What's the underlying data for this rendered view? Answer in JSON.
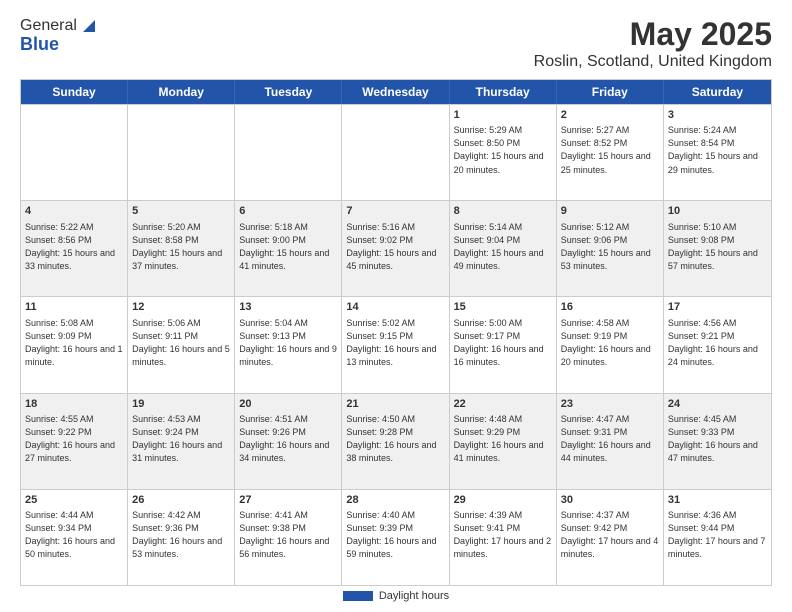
{
  "logo": {
    "general": "General",
    "blue": "Blue"
  },
  "title": "May 2025",
  "subtitle": "Roslin, Scotland, United Kingdom",
  "daylight_label": "Daylight hours",
  "weekdays": [
    "Sunday",
    "Monday",
    "Tuesday",
    "Wednesday",
    "Thursday",
    "Friday",
    "Saturday"
  ],
  "weeks": [
    [
      {
        "day": "",
        "info": ""
      },
      {
        "day": "",
        "info": ""
      },
      {
        "day": "",
        "info": ""
      },
      {
        "day": "",
        "info": ""
      },
      {
        "day": "1",
        "info": "Sunrise: 5:29 AM\nSunset: 8:50 PM\nDaylight: 15 hours and 20 minutes."
      },
      {
        "day": "2",
        "info": "Sunrise: 5:27 AM\nSunset: 8:52 PM\nDaylight: 15 hours and 25 minutes."
      },
      {
        "day": "3",
        "info": "Sunrise: 5:24 AM\nSunset: 8:54 PM\nDaylight: 15 hours and 29 minutes."
      }
    ],
    [
      {
        "day": "4",
        "info": "Sunrise: 5:22 AM\nSunset: 8:56 PM\nDaylight: 15 hours and 33 minutes."
      },
      {
        "day": "5",
        "info": "Sunrise: 5:20 AM\nSunset: 8:58 PM\nDaylight: 15 hours and 37 minutes."
      },
      {
        "day": "6",
        "info": "Sunrise: 5:18 AM\nSunset: 9:00 PM\nDaylight: 15 hours and 41 minutes."
      },
      {
        "day": "7",
        "info": "Sunrise: 5:16 AM\nSunset: 9:02 PM\nDaylight: 15 hours and 45 minutes."
      },
      {
        "day": "8",
        "info": "Sunrise: 5:14 AM\nSunset: 9:04 PM\nDaylight: 15 hours and 49 minutes."
      },
      {
        "day": "9",
        "info": "Sunrise: 5:12 AM\nSunset: 9:06 PM\nDaylight: 15 hours and 53 minutes."
      },
      {
        "day": "10",
        "info": "Sunrise: 5:10 AM\nSunset: 9:08 PM\nDaylight: 15 hours and 57 minutes."
      }
    ],
    [
      {
        "day": "11",
        "info": "Sunrise: 5:08 AM\nSunset: 9:09 PM\nDaylight: 16 hours and 1 minute."
      },
      {
        "day": "12",
        "info": "Sunrise: 5:06 AM\nSunset: 9:11 PM\nDaylight: 16 hours and 5 minutes."
      },
      {
        "day": "13",
        "info": "Sunrise: 5:04 AM\nSunset: 9:13 PM\nDaylight: 16 hours and 9 minutes."
      },
      {
        "day": "14",
        "info": "Sunrise: 5:02 AM\nSunset: 9:15 PM\nDaylight: 16 hours and 13 minutes."
      },
      {
        "day": "15",
        "info": "Sunrise: 5:00 AM\nSunset: 9:17 PM\nDaylight: 16 hours and 16 minutes."
      },
      {
        "day": "16",
        "info": "Sunrise: 4:58 AM\nSunset: 9:19 PM\nDaylight: 16 hours and 20 minutes."
      },
      {
        "day": "17",
        "info": "Sunrise: 4:56 AM\nSunset: 9:21 PM\nDaylight: 16 hours and 24 minutes."
      }
    ],
    [
      {
        "day": "18",
        "info": "Sunrise: 4:55 AM\nSunset: 9:22 PM\nDaylight: 16 hours and 27 minutes."
      },
      {
        "day": "19",
        "info": "Sunrise: 4:53 AM\nSunset: 9:24 PM\nDaylight: 16 hours and 31 minutes."
      },
      {
        "day": "20",
        "info": "Sunrise: 4:51 AM\nSunset: 9:26 PM\nDaylight: 16 hours and 34 minutes."
      },
      {
        "day": "21",
        "info": "Sunrise: 4:50 AM\nSunset: 9:28 PM\nDaylight: 16 hours and 38 minutes."
      },
      {
        "day": "22",
        "info": "Sunrise: 4:48 AM\nSunset: 9:29 PM\nDaylight: 16 hours and 41 minutes."
      },
      {
        "day": "23",
        "info": "Sunrise: 4:47 AM\nSunset: 9:31 PM\nDaylight: 16 hours and 44 minutes."
      },
      {
        "day": "24",
        "info": "Sunrise: 4:45 AM\nSunset: 9:33 PM\nDaylight: 16 hours and 47 minutes."
      }
    ],
    [
      {
        "day": "25",
        "info": "Sunrise: 4:44 AM\nSunset: 9:34 PM\nDaylight: 16 hours and 50 minutes."
      },
      {
        "day": "26",
        "info": "Sunrise: 4:42 AM\nSunset: 9:36 PM\nDaylight: 16 hours and 53 minutes."
      },
      {
        "day": "27",
        "info": "Sunrise: 4:41 AM\nSunset: 9:38 PM\nDaylight: 16 hours and 56 minutes."
      },
      {
        "day": "28",
        "info": "Sunrise: 4:40 AM\nSunset: 9:39 PM\nDaylight: 16 hours and 59 minutes."
      },
      {
        "day": "29",
        "info": "Sunrise: 4:39 AM\nSunset: 9:41 PM\nDaylight: 17 hours and 2 minutes."
      },
      {
        "day": "30",
        "info": "Sunrise: 4:37 AM\nSunset: 9:42 PM\nDaylight: 17 hours and 4 minutes."
      },
      {
        "day": "31",
        "info": "Sunrise: 4:36 AM\nSunset: 9:44 PM\nDaylight: 17 hours and 7 minutes."
      }
    ]
  ]
}
